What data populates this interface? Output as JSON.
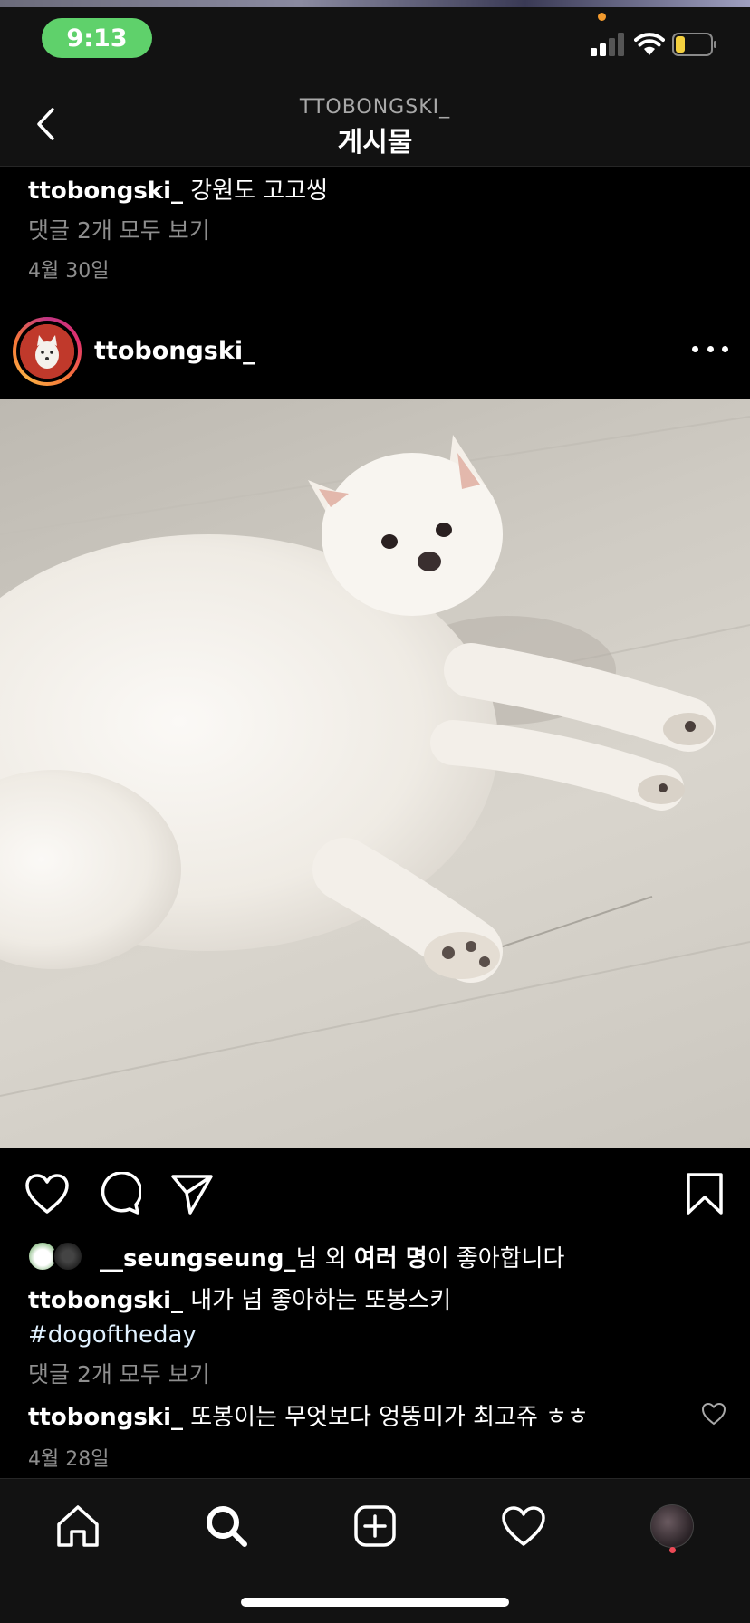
{
  "status_bar": {
    "time": "9:13",
    "icons": [
      "cellular-signal-icon",
      "wifi-icon",
      "battery-icon"
    ],
    "time_pill_color": "#5fd16b",
    "battery_color": "#f4d03f",
    "recording_dot_color": "#f29a2e"
  },
  "header": {
    "account": "TTOBONGSKI_",
    "title": "게시물",
    "back_icon": "chevron-left-icon"
  },
  "previous_post": {
    "username": "ttobongski_",
    "caption": "강원도 고고씽",
    "view_comments": "댓글 2개 모두 보기",
    "date": "4월 30일"
  },
  "post": {
    "username": "ttobongski_",
    "more_icon": "more-horizontal-icon",
    "image_alt": "white spitz dog lying on floor",
    "actions": [
      "heart-icon",
      "comment-icon",
      "share-icon",
      "bookmark-icon"
    ],
    "likes": {
      "first_liker": "__seungseung_",
      "suffix_1": "님 외 ",
      "others": "여러 명",
      "suffix_2": "이 좋아합니다"
    },
    "caption": {
      "username": "ttobongski_",
      "text": "내가 넘 좋아하는 또봉스키",
      "hashtag": "#dogoftheday"
    },
    "view_comments": "댓글 2개 모두 보기",
    "comment": {
      "username": "ttobongski_",
      "text": "또봉이는 무엇보다 엉뚱미가 최고쥬 ㅎㅎ"
    },
    "date": "4월 28일"
  },
  "tab_bar": {
    "tabs": [
      "home-icon",
      "search-icon",
      "new-post-icon",
      "activity-heart-icon",
      "profile-avatar"
    ],
    "notification_dot_color": "#ed4956"
  }
}
